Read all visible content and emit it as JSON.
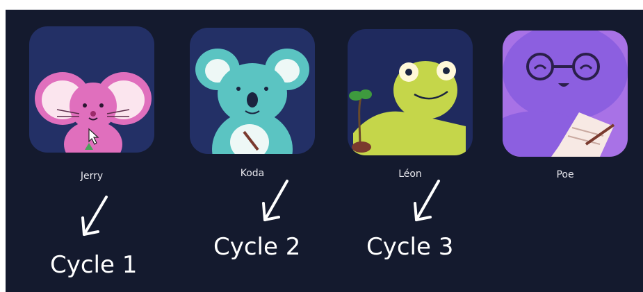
{
  "characters": [
    {
      "name": "Jerry",
      "cycle": "Cycle 1",
      "icon": "mouse-icon",
      "bg": "#233066",
      "color": "#e06fbd"
    },
    {
      "name": "Koda",
      "cycle": "Cycle 2",
      "icon": "koala-icon",
      "bg": "#233066",
      "color": "#5bc4c2"
    },
    {
      "name": "Léon",
      "cycle": "Cycle 3",
      "icon": "chameleon-icon",
      "bg": "#1f2a5e",
      "color": "#c5d64a"
    },
    {
      "name": "Poe",
      "cycle": "",
      "icon": "octopus-icon",
      "bg": "#a872e6",
      "color": "#8c5fe0"
    }
  ]
}
